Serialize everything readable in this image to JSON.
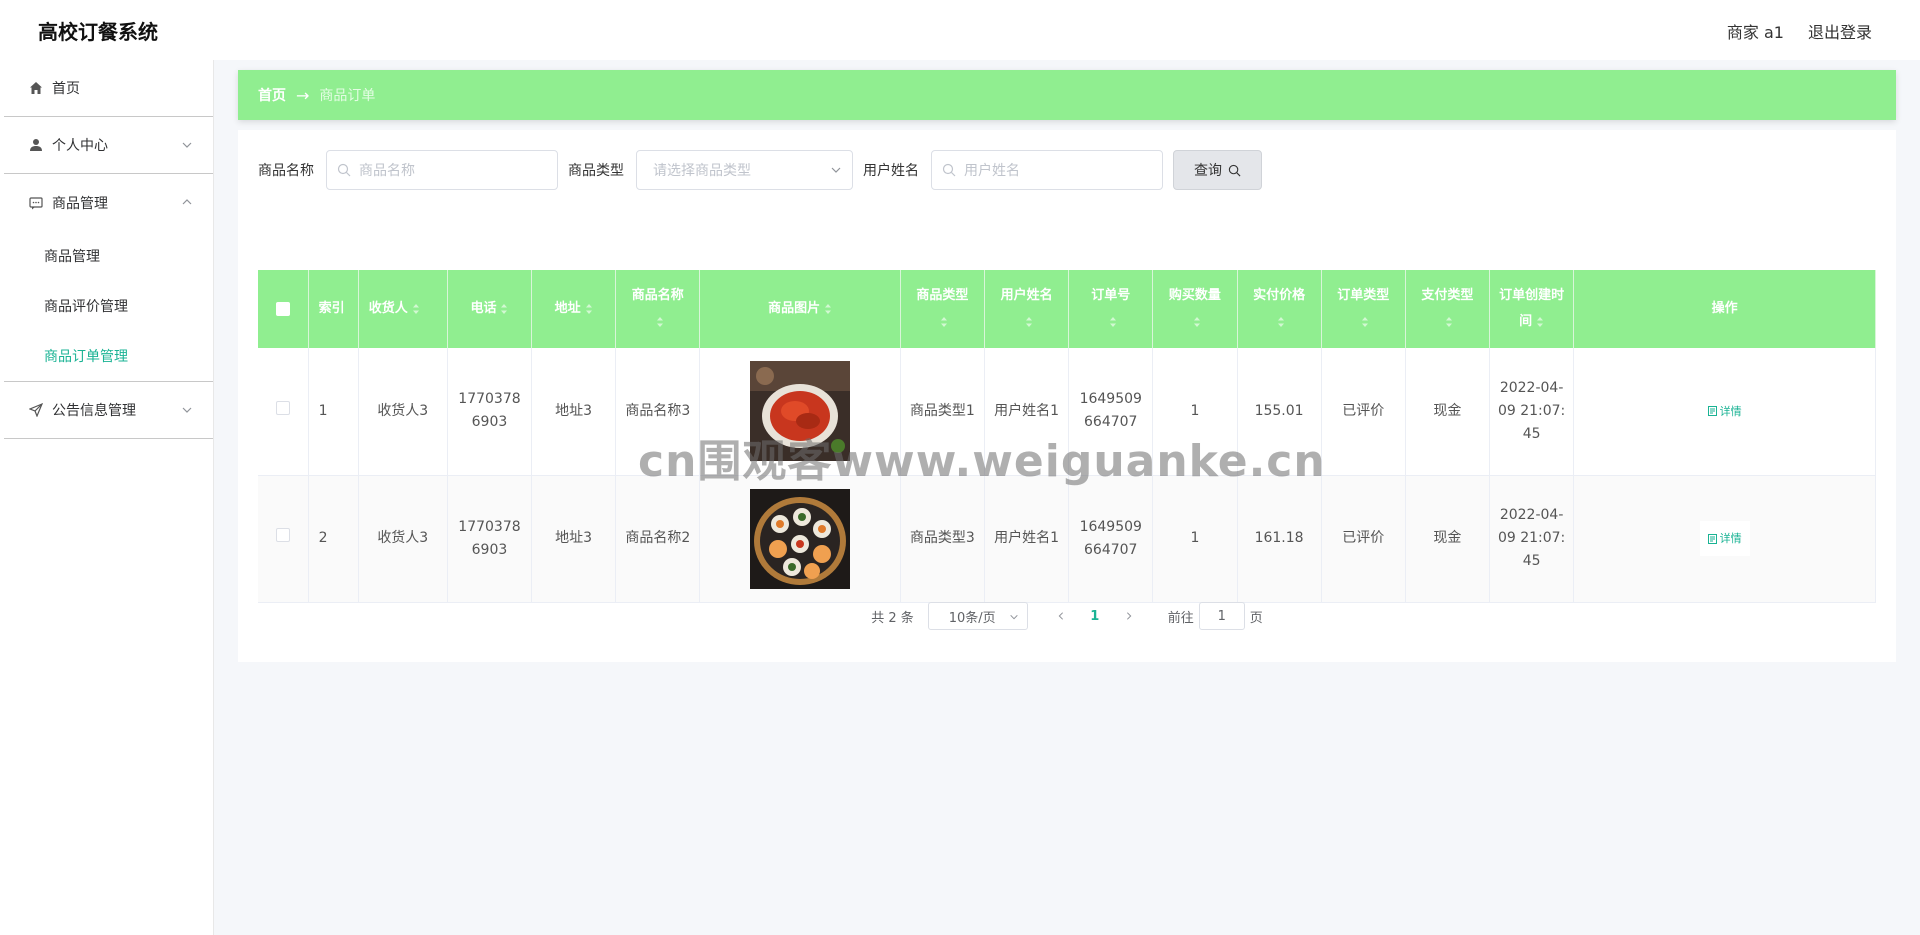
{
  "header": {
    "app_title": "高校订餐系统",
    "user_label": "商家 a1",
    "logout_label": "退出登录"
  },
  "sidebar": {
    "home": "首页",
    "personal_center": "个人中心",
    "product_mgmt": "商品管理",
    "sub_items": [
      "商品管理",
      "商品评价管理",
      "商品订单管理"
    ],
    "announcement": "公告信息管理"
  },
  "breadcrumb": {
    "home": "首页",
    "arrow": "→",
    "current": "商品订单"
  },
  "search": {
    "product_name_label": "商品名称",
    "product_name_placeholder": "商品名称",
    "product_type_label": "商品类型",
    "product_type_placeholder": "请选择商品类型",
    "user_name_label": "用户姓名",
    "user_name_placeholder": "用户姓名",
    "query_button": "查询"
  },
  "table": {
    "headers": [
      "索引",
      "收货人",
      "电话",
      "地址",
      "商品名称",
      "商品图片",
      "商品类型",
      "用户姓名",
      "订单号",
      "购买数量",
      "实付价格",
      "订单类型",
      "支付类型",
      "订单创建时间",
      "操作"
    ],
    "rows": [
      {
        "index": "1",
        "receiver": "收货人3",
        "phone": "17703786903",
        "address": "地址3",
        "product_name": "商品名称3",
        "product_type": "商品类型1",
        "user_name": "用户姓名1",
        "order_no": "1649509664707",
        "quantity": "1",
        "price": "155.01",
        "order_type": "已评价",
        "pay_type": "现金",
        "created": "2022-04-09 21:07:45",
        "action": "详情"
      },
      {
        "index": "2",
        "receiver": "收货人3",
        "phone": "17703786903",
        "address": "地址3",
        "product_name": "商品名称2",
        "product_type": "商品类型3",
        "user_name": "用户姓名1",
        "order_no": "1649509664707",
        "quantity": "1",
        "price": "161.18",
        "order_type": "已评价",
        "pay_type": "现金",
        "created": "2022-04-09 21:07:45",
        "action": "详情"
      }
    ]
  },
  "pagination": {
    "total": "共 2 条",
    "page_size": "10条/页",
    "current_page": "1",
    "goto_label": "前往",
    "goto_value": "1",
    "page_suffix": "页"
  },
  "watermark": "cn围观客www.weiguanke.cn",
  "colors": {
    "accent_green": "#90ee90",
    "active_teal": "#1ab394"
  }
}
